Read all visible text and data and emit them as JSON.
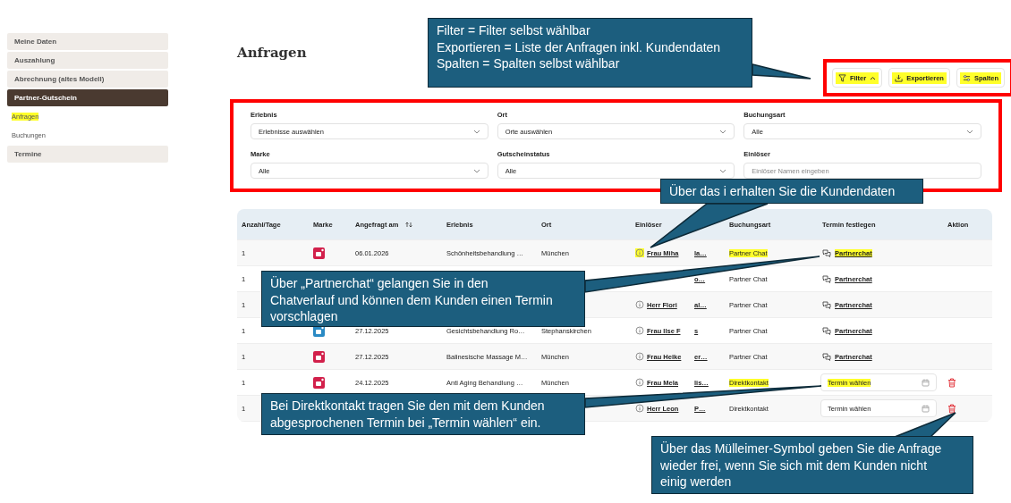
{
  "sidebar": {
    "items": [
      {
        "label": "Meine Daten",
        "kind": "section",
        "selected": false
      },
      {
        "label": "Auszahlung",
        "kind": "section",
        "selected": false
      },
      {
        "label": "Abrechnung (altes Modell)",
        "kind": "section",
        "selected": false
      },
      {
        "label": "Partner-Gutschein",
        "kind": "section",
        "selected": true
      },
      {
        "label": "Anfragen",
        "kind": "sub",
        "highlighted": true
      },
      {
        "label": "Buchungen",
        "kind": "sub",
        "highlighted": false
      },
      {
        "label": "Termine",
        "kind": "section",
        "selected": false
      }
    ]
  },
  "page_title": "Anfragen",
  "toolbar": [
    {
      "label": "Filter",
      "expanded": true,
      "highlighted": true
    },
    {
      "label": "Exportieren",
      "highlighted": true
    },
    {
      "label": "Spalten",
      "highlighted": true
    }
  ],
  "filters": [
    {
      "label": "Erlebnis",
      "kind": "select",
      "value": "Erlebnisse auswählen"
    },
    {
      "label": "Ort",
      "kind": "select",
      "value": "Orte auswählen"
    },
    {
      "label": "Buchungsart",
      "kind": "select",
      "value": "Alle"
    },
    {
      "label": "Marke",
      "kind": "select",
      "value": "Alle"
    },
    {
      "label": "Gutscheinstatus",
      "kind": "select",
      "value": "Alle"
    },
    {
      "label": "Einlöser",
      "kind": "text",
      "placeholder": "Einlöser Namen eingeben"
    }
  ],
  "table": {
    "columns": [
      "Anzahl/Tage",
      "Marke",
      "Angefragt am",
      "Erlebnis",
      "Ort",
      "Einlöser",
      "Buchungsart",
      "Termin festlegen",
      "Aktion"
    ],
    "rows": [
      {
        "anzahl": "1",
        "color": "#d2204b",
        "date": "06.01.2026",
        "erlebnis": "Schönheitsbehandlung …",
        "ort": "München",
        "info_highlighted": true,
        "name_start": "Frau Miha",
        "name_end": "la…",
        "buchungsart": "Partner Chat",
        "buchungsart_highlighted": true,
        "termin": {
          "kind": "chat",
          "label": "Partnerchat",
          "highlighted": true
        },
        "delete": false
      },
      {
        "anzahl": "1",
        "name_end": "o…",
        "buchungsart": "Partner Chat",
        "buchungsart_highlighted": false,
        "termin": {
          "kind": "chat",
          "label": "Partnerchat",
          "highlighted": false
        },
        "delete": false
      },
      {
        "anzahl": "1",
        "info_highlighted": false,
        "name_start": "Herr Flori",
        "name_end": "al…",
        "buchungsart": "Partner Chat",
        "buchungsart_highlighted": false,
        "termin": {
          "kind": "chat",
          "label": "Partnerchat",
          "highlighted": false
        },
        "delete": false
      },
      {
        "anzahl": "1",
        "color": "#2a8ac4",
        "date": "27.12.2025",
        "erlebnis": "Gesichtsbehandlung Ro…",
        "ort": "Stephanskirchen",
        "info_highlighted": false,
        "name_start": "Frau Ilse F",
        "name_end": "s",
        "buchungsart": "Partner Chat",
        "buchungsart_highlighted": false,
        "termin": {
          "kind": "chat",
          "label": "Partnerchat",
          "highlighted": false
        },
        "delete": false
      },
      {
        "anzahl": "1",
        "color": "#d2204b",
        "date": "27.12.2025",
        "erlebnis": "Balinesische Massage M…",
        "ort": "München",
        "info_highlighted": false,
        "name_start": "Frau Heike",
        "name_end": "er…",
        "buchungsart": "Partner Chat",
        "buchungsart_highlighted": false,
        "termin": {
          "kind": "chat",
          "label": "Partnerchat",
          "highlighted": false
        },
        "delete": false
      },
      {
        "anzahl": "1",
        "color": "#d2204b",
        "date": "24.12.2025",
        "erlebnis": "Anti Aging Behandlung …",
        "ort": "München",
        "info_highlighted": false,
        "name_start": "Frau Mela",
        "name_end": "lis…",
        "buchungsart": "Direktkontakt",
        "buchungsart_highlighted": true,
        "termin": {
          "kind": "date",
          "label": "Termin wählen",
          "highlighted": true
        },
        "delete": true
      },
      {
        "anzahl": "1",
        "info_highlighted": false,
        "name_start": "Herr Leon",
        "name_end": "P…",
        "buchungsart": "Direktkontakt",
        "buchungsart_highlighted": false,
        "termin": {
          "kind": "date",
          "label": "Termin wählen",
          "highlighted": false
        },
        "delete": true
      }
    ]
  },
  "annotations": [
    {
      "lines": [
        "Filter = Filter selbst wählbar",
        "Exportieren = Liste der Anfragen inkl. Kundendaten",
        "Spalten = Spalten selbst wählbar"
      ]
    },
    {
      "lines": [
        "Über das i erhalten Sie die Kundendaten"
      ]
    },
    {
      "lines": [
        "Über „Partnerchat“ gelangen Sie in den",
        "Chatverlauf und können dem Kunden einen Termin",
        "vorschlagen"
      ]
    },
    {
      "lines": [
        "Bei Direktkontakt tragen Sie den mit dem Kunden",
        "abgesprochenen Termin bei „Termin wählen“ ein."
      ]
    },
    {
      "lines": [
        "Über das Mülleimer-Symbol geben Sie die Anfrage",
        "wieder frei, wenn Sie sich mit dem Kunden nicht",
        "einig werden"
      ]
    }
  ]
}
